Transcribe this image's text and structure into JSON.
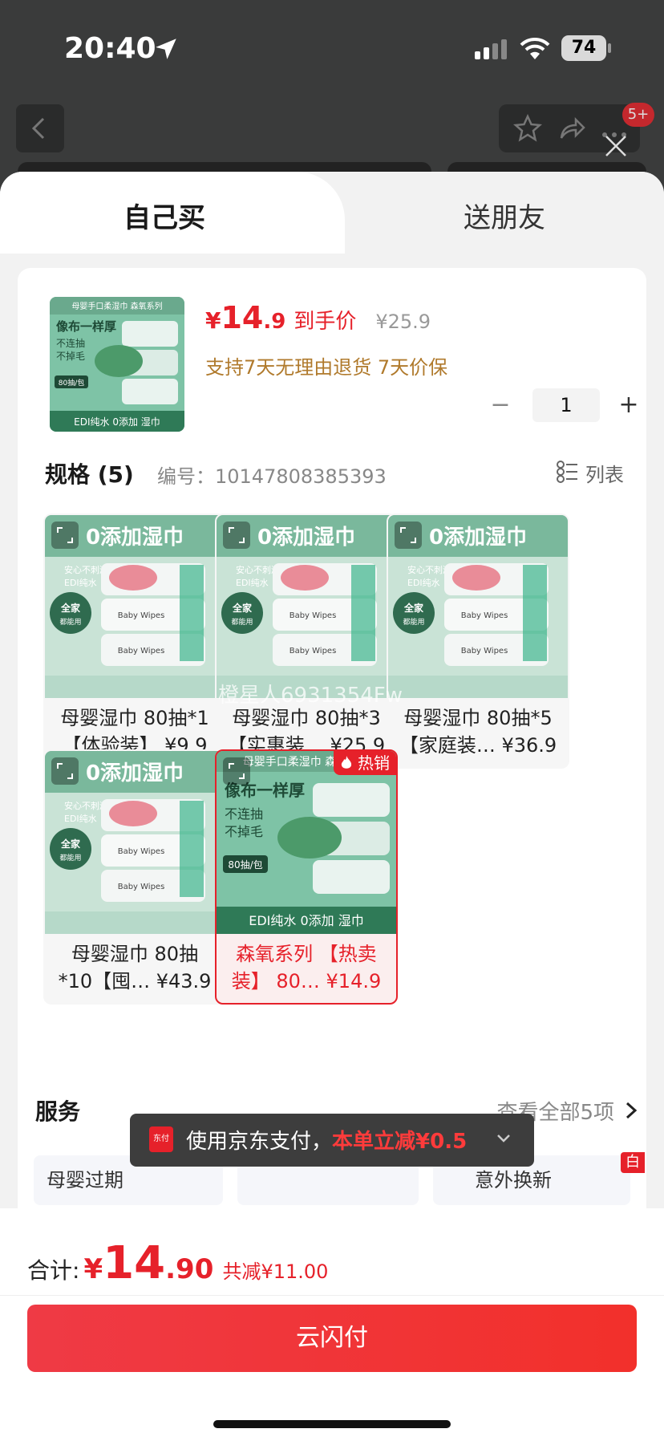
{
  "status_bar": {
    "time": "20:40",
    "battery": "74"
  },
  "nav": {
    "badge": "5+"
  },
  "tabs": {
    "buy_self": "自己买",
    "gift": "送朋友"
  },
  "product": {
    "thumb_title": "母婴手口柔湿巾  森氧系列",
    "thumb_line1": "像布一样厚",
    "thumb_line2": "不连抽",
    "thumb_line3": "不掉毛",
    "thumb_tag": "80抽/包",
    "thumb_footer": "EDI纯水  0添加 湿巾",
    "currency": "¥",
    "price_int": "14",
    "price_dec": ".9",
    "final_label": "到手价",
    "original_price": "¥25.9",
    "services": "支持7天无理由退货  7天价保",
    "quantity": "1",
    "minus": "−",
    "plus": "+"
  },
  "spec": {
    "title": "规格 (5)",
    "code_label": "编号：10147808385393",
    "list_label": "列表",
    "items": [
      {
        "img_title": "0添加湿巾",
        "line1": "母婴湿巾 80抽*1",
        "line2": "【体验装】 ¥9.9"
      },
      {
        "img_title": "0添加湿巾",
        "line1": "母婴湿巾 80抽*3",
        "line2": "【实惠装… ¥25.9"
      },
      {
        "img_title": "0添加湿巾",
        "line1": "母婴湿巾 80抽*5",
        "line2": "【家庭装… ¥36.9"
      },
      {
        "img_title": "0添加湿巾",
        "line1": "母婴湿巾 80抽",
        "line2": "*10【囤… ¥43.9"
      },
      {
        "img_title": "母婴手口柔湿巾  森氧系列",
        "line1": "森氧系列 【热卖",
        "line2": "装】 80… ¥14.9",
        "badge": "热销"
      }
    ],
    "img_sub1": "安心不刺激",
    "img_sub2": "EDI纯水",
    "img_circle1": "全家",
    "img_circle2": "都能用",
    "pack_label": "Baby Wipes"
  },
  "services": {
    "title": "服务",
    "view_all": "查看全部5项",
    "item1": "母婴过期",
    "item3": "意外换新",
    "tag": "白条"
  },
  "toast": {
    "prefix": "使用京东支付，",
    "highlight": "本单立减¥0.5",
    "icon_text": "东付"
  },
  "watermark": "橙星人6931354Fw",
  "bottom": {
    "total_label": "合计:",
    "currency": "¥",
    "total_int": "14",
    "total_dec": ".90",
    "discount": "共减¥11.00",
    "pay_button": "云闪付"
  },
  "colors": {
    "accent": "#e6212a",
    "service_gold": "#b07a2c",
    "product_green": "#7ec3a6"
  }
}
